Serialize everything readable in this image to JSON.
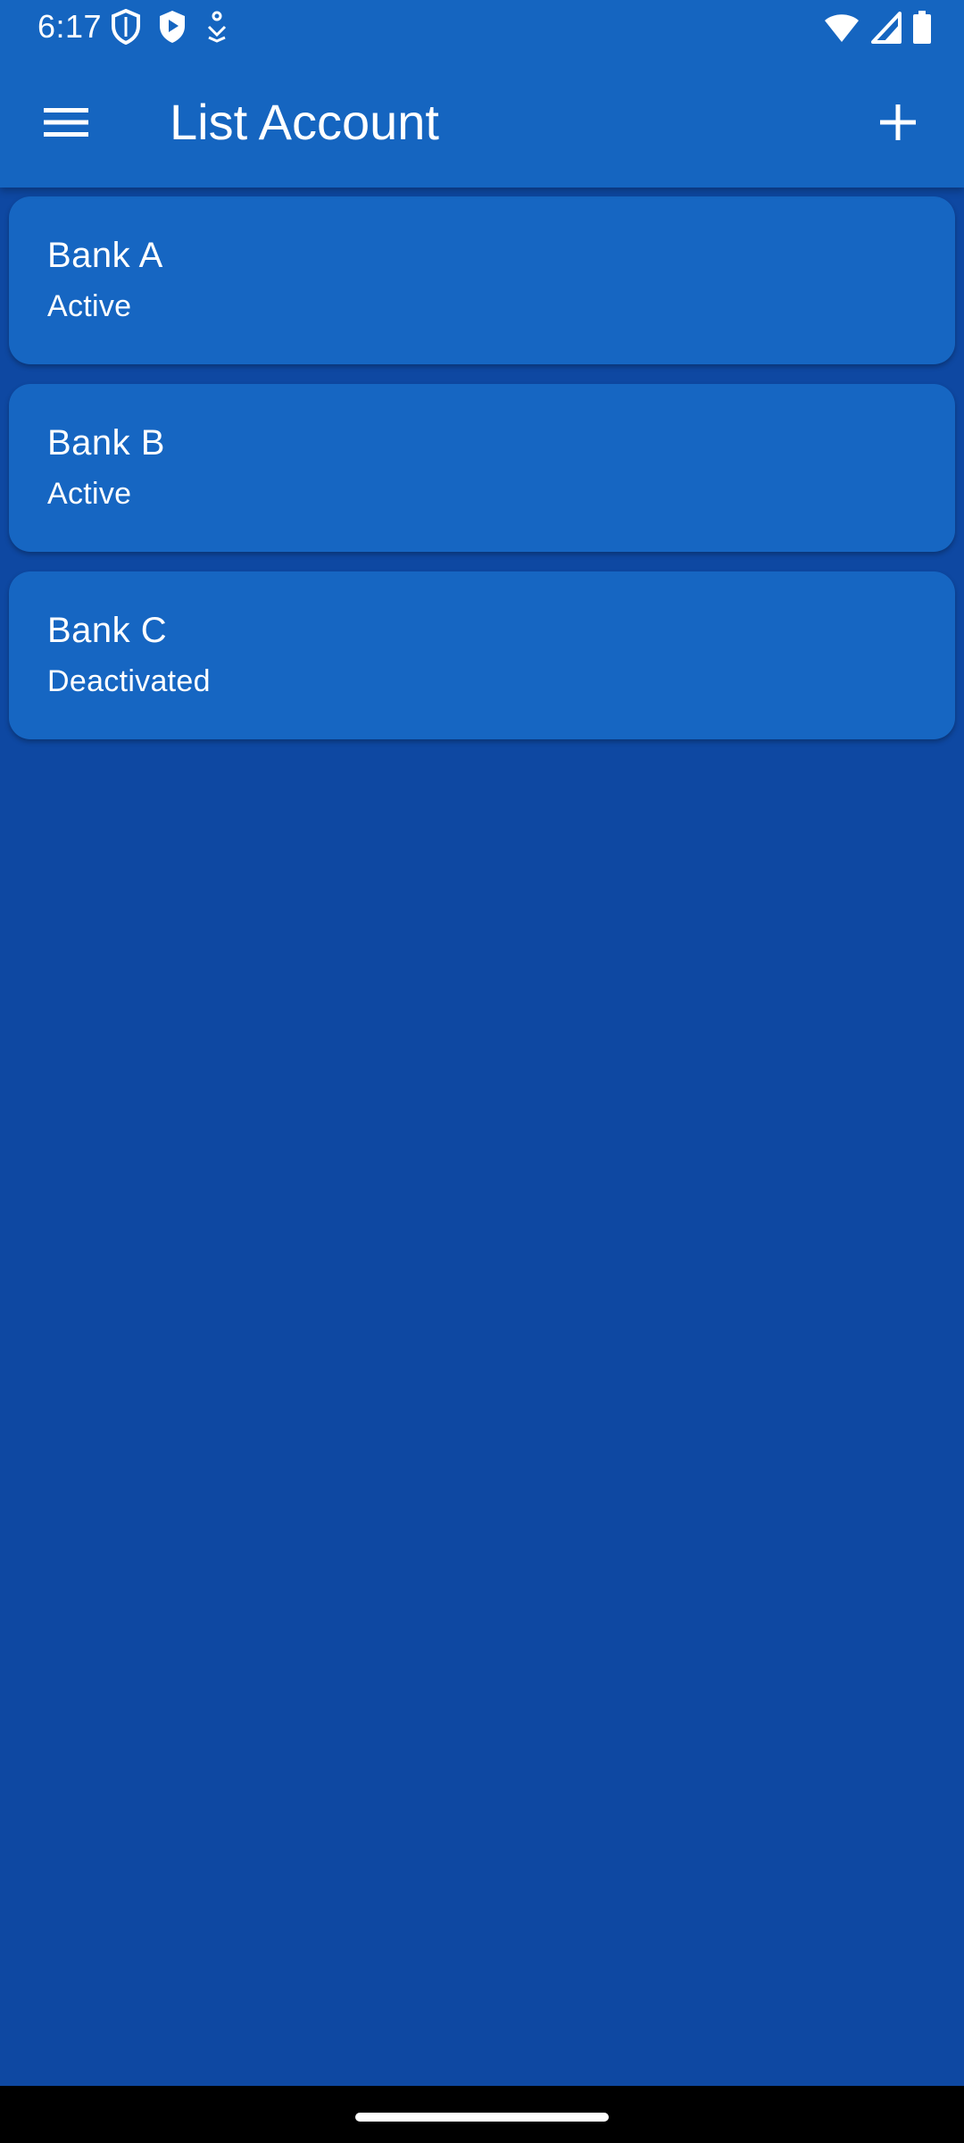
{
  "status_bar": {
    "time": "6:17",
    "icons": [
      "shield-icon",
      "play-shield-icon",
      "download-icon",
      "wifi-icon",
      "signal-icon",
      "battery-icon"
    ]
  },
  "app_bar": {
    "title": "List Account",
    "menu_icon": "hamburger-menu-icon",
    "add_icon": "plus-icon"
  },
  "accounts": [
    {
      "name": "Bank A",
      "status": "Active"
    },
    {
      "name": "Bank B",
      "status": "Active"
    },
    {
      "name": "Bank C",
      "status": "Deactivated"
    }
  ],
  "colors": {
    "app_bar": "#1565c0",
    "background": "#0e48a2",
    "card": "#1666c2",
    "text": "#ffffff"
  }
}
